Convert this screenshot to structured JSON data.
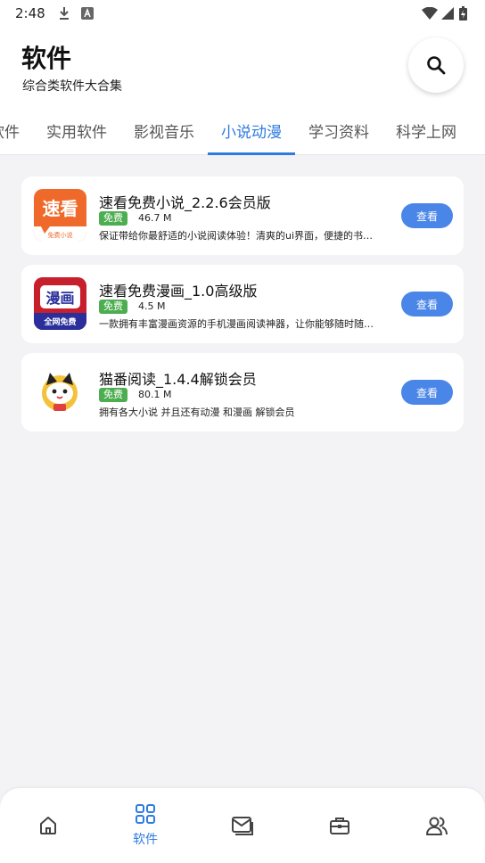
{
  "status_bar": {
    "time": "2:48"
  },
  "header": {
    "title": "软件",
    "subtitle": "综合类软件大合集"
  },
  "tabs": [
    {
      "label": "软件"
    },
    {
      "label": "实用软件"
    },
    {
      "label": "影视音乐"
    },
    {
      "label": "小说动漫",
      "active": true
    },
    {
      "label": "学习资料"
    },
    {
      "label": "科学上网"
    }
  ],
  "apps": [
    {
      "name": "速看免费小说_2.2.6会员版",
      "badge": "免费",
      "size": "46.7 M",
      "desc": "保证带给你最舒适的小说阅读体验！清爽的ui界面，便捷的书…",
      "button": "查看",
      "icon": "suka-novel-icon",
      "icon_text": "速看",
      "icon_sub": "免费小说"
    },
    {
      "name": "速看免费漫画_1.0高级版",
      "badge": "免费",
      "size": "4.5 M",
      "desc": "一款拥有丰富漫画资源的手机漫画阅读神器，让你能够随时随…",
      "button": "查看",
      "icon": "suka-comic-icon",
      "icon_text": "漫画",
      "icon_sub": "全网免费"
    },
    {
      "name": "猫番阅读_1.4.4解锁会员",
      "badge": "免费",
      "size": "80.1 M",
      "desc": "拥有各大小说 并且还有动漫 和漫画 解锁会员",
      "button": "查看",
      "icon": "maofan-cat-icon"
    }
  ],
  "bottom_nav": [
    {
      "icon": "home-icon"
    },
    {
      "icon": "grid-icon",
      "label": "软件",
      "active": true
    },
    {
      "icon": "mail-icon"
    },
    {
      "icon": "toolbox-icon"
    },
    {
      "icon": "users-icon"
    }
  ],
  "colors": {
    "accent": "#2f7be0",
    "button": "#4a86e8",
    "badge": "#4cae50",
    "background": "#f3f3f5"
  }
}
